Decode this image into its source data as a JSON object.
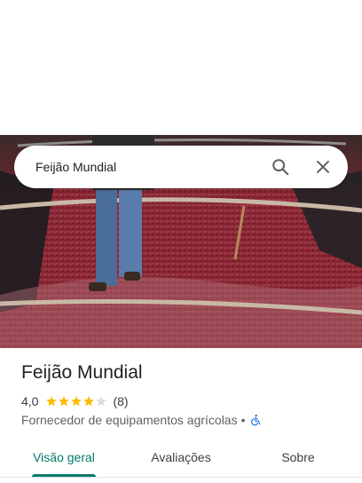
{
  "search": {
    "query": "Feijão Mundial"
  },
  "place": {
    "name": "Feijão Mundial",
    "rating_text": "4,0",
    "rating_value": 4,
    "rating_max": 5,
    "review_count_text": "(8)",
    "category": "Fornecedor de equipamentos agrícolas",
    "separator": "•"
  },
  "tabs": [
    {
      "label": "Visão geral",
      "active": true
    },
    {
      "label": "Avaliações",
      "active": false
    },
    {
      "label": "Sobre",
      "active": false
    }
  ],
  "icons": {
    "search": "search-icon",
    "close": "close-icon",
    "star": "star-icon",
    "accessibility": "wheelchair-icon"
  },
  "colors": {
    "accent": "#00796b",
    "star_filled": "#fbbc04",
    "star_empty": "#dadce0",
    "accessibility": "#1a73e8"
  }
}
